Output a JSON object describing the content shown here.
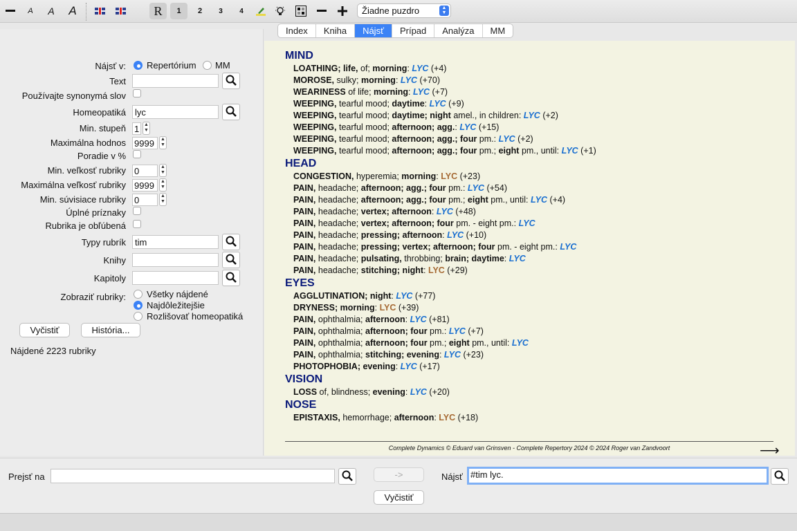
{
  "toolbar": {
    "font_a_small": "A",
    "font_a_medium": "A",
    "font_a_large": "A",
    "r_label": "R",
    "degree_1": "1",
    "degree_2": "2",
    "degree_3": "3",
    "degree_4": "4",
    "remedy_box_select": "Žiadne puzdro"
  },
  "tabs": [
    "Index",
    "Kniha",
    "Nájsť",
    "Prípad",
    "Analýza",
    "MM"
  ],
  "active_tab": "Nájsť",
  "search_form": {
    "search_in_label": "Nájsť v:",
    "search_in_options": [
      "Repertórium",
      "MM"
    ],
    "text_label": "Text",
    "text_value": "",
    "synonyms_label": "Používajte synonymá slov",
    "remedy_label": "Homeopatiká",
    "remedy_value": "lyc",
    "min_degree_label": "Min. stupeň",
    "min_degree_value": "1",
    "max_value_label": "Maximálna hodnos",
    "max_value_value": "9999",
    "order_percent_label": "Poradie v %",
    "min_rubric_size_label": "Min. veľkosť rubriky",
    "min_rubric_size_value": "0",
    "max_rubric_size_label": "Maximálna veľkosť rubriky",
    "max_rubric_size_value": "9999",
    "min_related_label": "Min. súvisiace rubriky",
    "min_related_value": "0",
    "full_symptoms_label": "Úplné príznaky",
    "favorite_label": "Rubrika je obľúbená",
    "rubric_types_label": "Typy rubrík",
    "rubric_types_value": "tim",
    "books_label": "Knihy",
    "books_value": "",
    "chapters_label": "Kapitoly",
    "chapters_value": "",
    "show_rubrics_label": "Zobraziť rubriky:",
    "show_options": [
      "Všetky nájdené",
      "Najdôležitejšie",
      "Rozlišovať homeopatiká"
    ],
    "clear_button": "Vyčistiť",
    "history_button": "História...",
    "found_text": "Nájdené 2223 rubriky"
  },
  "results": [
    {
      "section": "MIND",
      "items": [
        [
          [
            "b",
            "LOATHING; life, "
          ],
          [
            "n",
            "of; "
          ],
          [
            "b",
            "morning"
          ],
          [
            "n",
            ": "
          ],
          [
            "r",
            "LYC"
          ],
          [
            "n",
            " (+4)"
          ]
        ],
        [
          [
            "b",
            "MOROSE, "
          ],
          [
            "n",
            "sulky; "
          ],
          [
            "b",
            "morning"
          ],
          [
            "n",
            ": "
          ],
          [
            "r",
            "LYC"
          ],
          [
            "n",
            " (+70)"
          ]
        ],
        [
          [
            "b",
            "WEARINESS "
          ],
          [
            "n",
            "of life; "
          ],
          [
            "b",
            "morning"
          ],
          [
            "n",
            ": "
          ],
          [
            "r",
            "LYC"
          ],
          [
            "n",
            " (+7)"
          ]
        ],
        [
          [
            "b",
            "WEEPING, "
          ],
          [
            "n",
            "tearful mood; "
          ],
          [
            "b",
            "daytime"
          ],
          [
            "n",
            ": "
          ],
          [
            "r",
            "LYC"
          ],
          [
            "n",
            " (+9)"
          ]
        ],
        [
          [
            "b",
            "WEEPING, "
          ],
          [
            "n",
            "tearful mood; "
          ],
          [
            "b",
            "daytime; night "
          ],
          [
            "n",
            "amel., in children: "
          ],
          [
            "r",
            "LYC"
          ],
          [
            "n",
            " (+2)"
          ]
        ],
        [
          [
            "b",
            "WEEPING, "
          ],
          [
            "n",
            "tearful mood; "
          ],
          [
            "b",
            "afternoon; agg."
          ],
          [
            "n",
            ": "
          ],
          [
            "r",
            "LYC"
          ],
          [
            "n",
            " (+15)"
          ]
        ],
        [
          [
            "b",
            "WEEPING, "
          ],
          [
            "n",
            "tearful mood; "
          ],
          [
            "b",
            "afternoon; agg.; four "
          ],
          [
            "n",
            "pm.: "
          ],
          [
            "r",
            "LYC"
          ],
          [
            "n",
            " (+2)"
          ]
        ],
        [
          [
            "b",
            "WEEPING, "
          ],
          [
            "n",
            "tearful mood; "
          ],
          [
            "b",
            "afternoon; agg.; four "
          ],
          [
            "n",
            "pm.; "
          ],
          [
            "b",
            "eight "
          ],
          [
            "n",
            "pm., until: "
          ],
          [
            "r",
            "LYC"
          ],
          [
            "n",
            " (+1)"
          ]
        ]
      ]
    },
    {
      "section": "HEAD",
      "items": [
        [
          [
            "b",
            "CONGESTION, "
          ],
          [
            "n",
            "hyperemia; "
          ],
          [
            "b",
            "morning"
          ],
          [
            "n",
            ": "
          ],
          [
            "g",
            "LYC"
          ],
          [
            "n",
            " (+23)"
          ]
        ],
        [
          [
            "b",
            "PAIN, "
          ],
          [
            "n",
            "headache; "
          ],
          [
            "b",
            "afternoon; agg.; four "
          ],
          [
            "n",
            "pm.: "
          ],
          [
            "r",
            "LYC"
          ],
          [
            "n",
            " (+54)"
          ]
        ],
        [
          [
            "b",
            "PAIN, "
          ],
          [
            "n",
            "headache; "
          ],
          [
            "b",
            "afternoon; agg.; four "
          ],
          [
            "n",
            "pm.; "
          ],
          [
            "b",
            "eight "
          ],
          [
            "n",
            "pm., until: "
          ],
          [
            "r",
            "LYC"
          ],
          [
            "n",
            " (+4)"
          ]
        ],
        [
          [
            "b",
            "PAIN, "
          ],
          [
            "n",
            "headache; "
          ],
          [
            "b",
            "vertex; afternoon"
          ],
          [
            "n",
            ": "
          ],
          [
            "r",
            "LYC"
          ],
          [
            "n",
            " (+48)"
          ]
        ],
        [
          [
            "b",
            "PAIN, "
          ],
          [
            "n",
            "headache; "
          ],
          [
            "b",
            "vertex; afternoon; four "
          ],
          [
            "n",
            "pm. - eight pm.: "
          ],
          [
            "r",
            "LYC"
          ]
        ],
        [
          [
            "b",
            "PAIN, "
          ],
          [
            "n",
            "headache; "
          ],
          [
            "b",
            "pressing; afternoon"
          ],
          [
            "n",
            ": "
          ],
          [
            "r",
            "LYC"
          ],
          [
            "n",
            " (+10)"
          ]
        ],
        [
          [
            "b",
            "PAIN, "
          ],
          [
            "n",
            "headache; "
          ],
          [
            "b",
            "pressing; vertex; afternoon; four "
          ],
          [
            "n",
            "pm. - eight pm.: "
          ],
          [
            "r",
            "LYC"
          ]
        ],
        [
          [
            "b",
            "PAIN, "
          ],
          [
            "n",
            "headache; "
          ],
          [
            "b",
            "pulsating, "
          ],
          [
            "n",
            "throbbing; "
          ],
          [
            "b",
            "brain; daytime"
          ],
          [
            "n",
            ": "
          ],
          [
            "r",
            "LYC"
          ]
        ],
        [
          [
            "b",
            "PAIN, "
          ],
          [
            "n",
            "headache; "
          ],
          [
            "b",
            "stitching; night"
          ],
          [
            "n",
            ": "
          ],
          [
            "g",
            "LYC"
          ],
          [
            "n",
            " (+29)"
          ]
        ]
      ]
    },
    {
      "section": "EYES",
      "items": [
        [
          [
            "b",
            "AGGLUTINATION; night"
          ],
          [
            "n",
            ": "
          ],
          [
            "r",
            "LYC"
          ],
          [
            "n",
            " (+77)"
          ]
        ],
        [
          [
            "b",
            "DRYNESS; morning"
          ],
          [
            "n",
            ": "
          ],
          [
            "g",
            "LYC"
          ],
          [
            "n",
            " (+39)"
          ]
        ],
        [
          [
            "b",
            "PAIN, "
          ],
          [
            "n",
            "ophthalmia; "
          ],
          [
            "b",
            "afternoon"
          ],
          [
            "n",
            ": "
          ],
          [
            "r",
            "LYC"
          ],
          [
            "n",
            " (+81)"
          ]
        ],
        [
          [
            "b",
            "PAIN, "
          ],
          [
            "n",
            "ophthalmia; "
          ],
          [
            "b",
            "afternoon; four "
          ],
          [
            "n",
            "pm.: "
          ],
          [
            "r",
            "LYC"
          ],
          [
            "n",
            " (+7)"
          ]
        ],
        [
          [
            "b",
            "PAIN, "
          ],
          [
            "n",
            "ophthalmia; "
          ],
          [
            "b",
            "afternoon; four "
          ],
          [
            "n",
            "pm.; "
          ],
          [
            "b",
            "eight "
          ],
          [
            "n",
            "pm., until: "
          ],
          [
            "r",
            "LYC"
          ]
        ],
        [
          [
            "b",
            "PAIN, "
          ],
          [
            "n",
            "ophthalmia; "
          ],
          [
            "b",
            "stitching; evening"
          ],
          [
            "n",
            ": "
          ],
          [
            "r",
            "LYC"
          ],
          [
            "n",
            " (+23)"
          ]
        ],
        [
          [
            "b",
            "PHOTOPHOBIA; evening"
          ],
          [
            "n",
            ": "
          ],
          [
            "r",
            "LYC"
          ],
          [
            "n",
            " (+17)"
          ]
        ]
      ]
    },
    {
      "section": "VISION",
      "items": [
        [
          [
            "b",
            "LOSS "
          ],
          [
            "n",
            "of, blindness; "
          ],
          [
            "b",
            "evening"
          ],
          [
            "n",
            ": "
          ],
          [
            "r",
            "LYC"
          ],
          [
            "n",
            " (+20)"
          ]
        ]
      ]
    },
    {
      "section": "NOSE",
      "items": [
        [
          [
            "b",
            "EPISTAXIS, "
          ],
          [
            "n",
            "hemorrhage; "
          ],
          [
            "b",
            "afternoon"
          ],
          [
            "n",
            ": "
          ],
          [
            "g",
            "LYC"
          ],
          [
            "n",
            " (+18)"
          ]
        ]
      ]
    }
  ],
  "footer_text": "Complete Dynamics © Eduard van Grinsven   -   Complete Repertory 2024 © 2024 Roger van Zandvoort",
  "bottom": {
    "goto_label": "Prejsť na",
    "goto_value": "",
    "arrow_button": "->",
    "find_label": "Nájsť",
    "find_value": "#tim lyc.",
    "clear_button": "Vyčistiť"
  },
  "colors": {
    "accent": "#3b82f6",
    "section": "#0a1a7a",
    "remedy_italic": "#1a6fd0",
    "remedy_plain": "#a66a34",
    "content_bg": "#f3f3e2"
  }
}
